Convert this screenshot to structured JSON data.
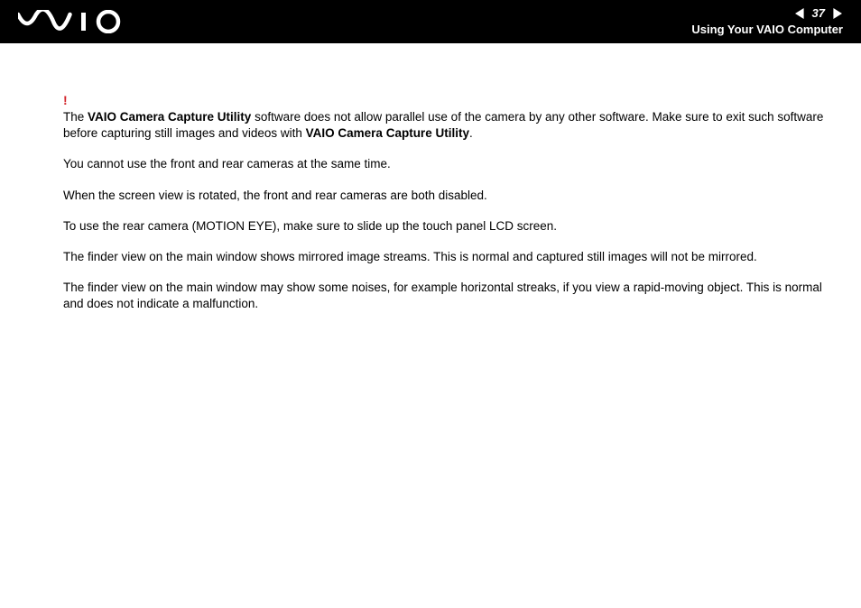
{
  "header": {
    "page_number": "37",
    "section_title": "Using Your VAIO Computer"
  },
  "content": {
    "warn_symbol": "!",
    "p1_a": "The ",
    "p1_b_bold": "VAIO Camera Capture Utility",
    "p1_c": " software does not allow parallel use of the camera by any other software. Make sure to exit such software before capturing still images and videos with ",
    "p1_d_bold": "VAIO Camera Capture Utility",
    "p1_e": ".",
    "p2": "You cannot use the front and rear cameras at the same time.",
    "p3": "When the screen view is rotated, the front and rear cameras are both disabled.",
    "p4": "To use the rear camera (MOTION EYE), make sure to slide up the touch panel LCD screen.",
    "p5": "The finder view on the main window shows mirrored image streams. This is normal and captured still images will not be mirrored.",
    "p6": "The finder view on the main window may show some noises, for example horizontal streaks, if you view a rapid-moving object. This is normal and does not indicate a malfunction."
  }
}
